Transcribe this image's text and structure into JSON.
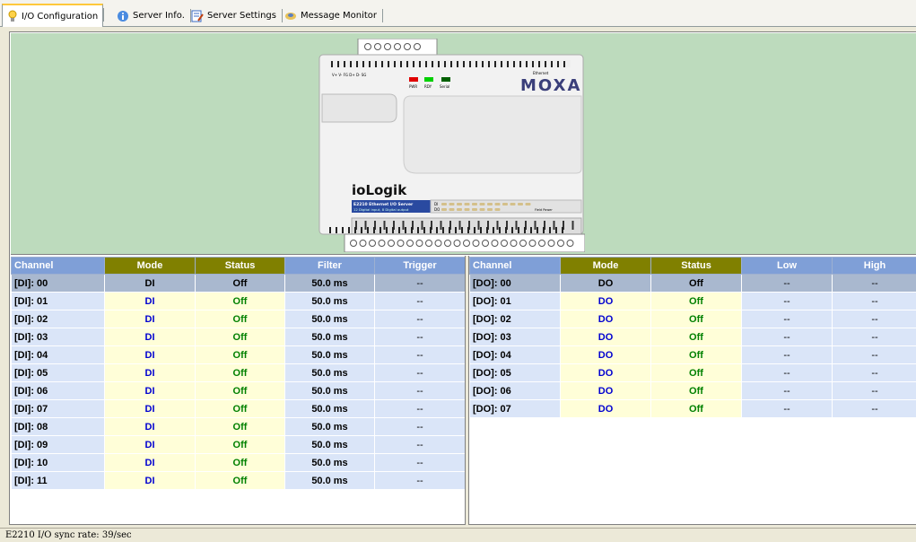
{
  "tabs": [
    {
      "label": "I/O Configuration",
      "icon": "lightbulb-icon",
      "active": true
    },
    {
      "label": "Server Info.",
      "icon": "info-icon",
      "active": false
    },
    {
      "label": "Server Settings",
      "icon": "settings-icon",
      "active": false
    },
    {
      "label": "Message Monitor",
      "icon": "monitor-icon",
      "active": false
    }
  ],
  "device": {
    "brand": "MOXA",
    "product": "ioLogik",
    "model_line1": "E2210 Ethernet I/O Server",
    "model_line2": "12 Digital input, 8 Digital output",
    "top_terminals": "V+ V- FG D+ D- SG",
    "leds": [
      "PWR",
      "RDY",
      "Serial"
    ],
    "ethernet_label": "Ethernet",
    "field_power": "Field Power",
    "di_label": "DI",
    "do_label": "DO"
  },
  "di_table": {
    "headers": [
      "Channel",
      "Mode",
      "Status",
      "Filter",
      "Trigger"
    ],
    "rows": [
      [
        "[DI]: 00",
        "DI",
        "Off",
        "50.0 ms",
        "--"
      ],
      [
        "[DI]: 01",
        "DI",
        "Off",
        "50.0 ms",
        "--"
      ],
      [
        "[DI]: 02",
        "DI",
        "Off",
        "50.0 ms",
        "--"
      ],
      [
        "[DI]: 03",
        "DI",
        "Off",
        "50.0 ms",
        "--"
      ],
      [
        "[DI]: 04",
        "DI",
        "Off",
        "50.0 ms",
        "--"
      ],
      [
        "[DI]: 05",
        "DI",
        "Off",
        "50.0 ms",
        "--"
      ],
      [
        "[DI]: 06",
        "DI",
        "Off",
        "50.0 ms",
        "--"
      ],
      [
        "[DI]: 07",
        "DI",
        "Off",
        "50.0 ms",
        "--"
      ],
      [
        "[DI]: 08",
        "DI",
        "Off",
        "50.0 ms",
        "--"
      ],
      [
        "[DI]: 09",
        "DI",
        "Off",
        "50.0 ms",
        "--"
      ],
      [
        "[DI]: 10",
        "DI",
        "Off",
        "50.0 ms",
        "--"
      ],
      [
        "[DI]: 11",
        "DI",
        "Off",
        "50.0 ms",
        "--"
      ]
    ]
  },
  "do_table": {
    "headers": [
      "Channel",
      "Mode",
      "Status",
      "Low",
      "High"
    ],
    "rows": [
      [
        "[DO]: 00",
        "DO",
        "Off",
        "--",
        "--"
      ],
      [
        "[DO]: 01",
        "DO",
        "Off",
        "--",
        "--"
      ],
      [
        "[DO]: 02",
        "DO",
        "Off",
        "--",
        "--"
      ],
      [
        "[DO]: 03",
        "DO",
        "Off",
        "--",
        "--"
      ],
      [
        "[DO]: 04",
        "DO",
        "Off",
        "--",
        "--"
      ],
      [
        "[DO]: 05",
        "DO",
        "Off",
        "--",
        "--"
      ],
      [
        "[DO]: 06",
        "DO",
        "Off",
        "--",
        "--"
      ],
      [
        "[DO]: 07",
        "DO",
        "Off",
        "--",
        "--"
      ]
    ]
  },
  "status_bar": "E2210 I/O sync rate: 39/sec",
  "colors": {
    "header_blue": "#7f9fd7",
    "header_olive": "#808000",
    "mode_text": "#0000d0",
    "status_text": "#008000",
    "selected_row": "#a9b8cf"
  }
}
